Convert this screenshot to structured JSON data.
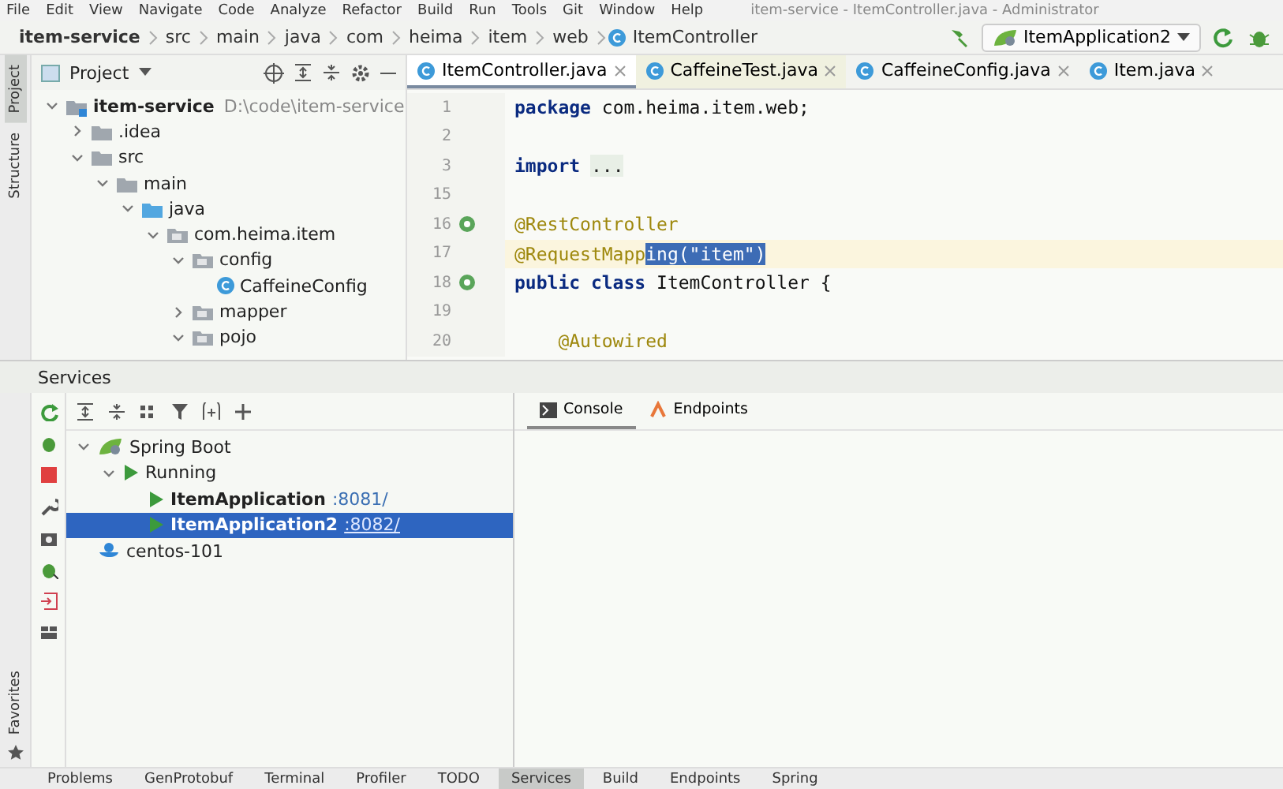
{
  "menu": [
    "File",
    "Edit",
    "View",
    "Navigate",
    "Code",
    "Analyze",
    "Refactor",
    "Build",
    "Run",
    "Tools",
    "Git",
    "Window",
    "Help"
  ],
  "window": {
    "title": "item-service - ItemController.java - Administrator"
  },
  "breadcrumbs": [
    "item-service",
    "src",
    "main",
    "java",
    "com",
    "heima",
    "item",
    "web",
    "ItemController"
  ],
  "run_config": {
    "label": "ItemApplication2"
  },
  "side_tabs": [
    {
      "label": "Project",
      "selected": true
    },
    {
      "label": "Structure",
      "selected": false
    }
  ],
  "project_panel": {
    "title": "Project",
    "tree": [
      {
        "label": "item-service",
        "path": "D:\\code\\item-service",
        "kind": "module",
        "expanded": true,
        "children": [
          {
            "label": ".idea",
            "kind": "folder",
            "expanded": false
          },
          {
            "label": "src",
            "kind": "folder",
            "expanded": true,
            "children": [
              {
                "label": "main",
                "kind": "folder",
                "expanded": true,
                "children": [
                  {
                    "label": "java",
                    "kind": "source",
                    "expanded": true,
                    "children": [
                      {
                        "label": "com.heima.item",
                        "kind": "package",
                        "expanded": true,
                        "children": [
                          {
                            "label": "config",
                            "kind": "package",
                            "expanded": true,
                            "children": [
                              {
                                "label": "CaffeineConfig",
                                "kind": "class"
                              }
                            ]
                          },
                          {
                            "label": "mapper",
                            "kind": "package",
                            "expanded": false
                          },
                          {
                            "label": "pojo",
                            "kind": "package",
                            "expanded": true
                          }
                        ]
                      }
                    ]
                  }
                ]
              }
            ]
          }
        ]
      }
    ]
  },
  "editor_tabs": [
    {
      "label": "ItemController.java",
      "selected": true
    },
    {
      "label": "CaffeineTest.java",
      "selected": false
    },
    {
      "label": "CaffeineConfig.java",
      "selected": false
    },
    {
      "label": "Item.java",
      "selected": false
    }
  ],
  "code_lines": [
    {
      "number": "1",
      "current": false,
      "tokens": [
        {
          "kind": "keyword",
          "text": "package"
        },
        {
          "kind": "plain",
          "text": " com.heima.item.web;"
        }
      ]
    },
    {
      "number": "2",
      "current": false
    },
    {
      "number": "3",
      "current": false,
      "tokens": [
        {
          "kind": "keyword",
          "text": "import"
        },
        {
          "kind": "folded",
          "text": "..."
        }
      ]
    },
    {
      "number": "15",
      "current": false
    },
    {
      "number": "16",
      "current": false,
      "bean_icon": true,
      "tokens": [
        {
          "kind": "annotation",
          "text": "@RestController"
        }
      ]
    },
    {
      "number": "17",
      "current": true,
      "tokens": [
        {
          "kind": "annotation",
          "text": "@RequestMapp"
        },
        {
          "kind": "selection",
          "text": "ing(\"item\")"
        }
      ]
    },
    {
      "number": "18",
      "current": false,
      "bean_icon": true,
      "tokens": [
        {
          "kind": "keyword",
          "text": "public class"
        },
        {
          "kind": "plain",
          "text": " ItemController {"
        }
      ]
    },
    {
      "number": "19",
      "current": false
    },
    {
      "number": "20",
      "current": false,
      "indented": true,
      "tokens": [
        {
          "kind": "annotation",
          "text": "@Autowired"
        }
      ]
    }
  ],
  "services": {
    "title": "Services",
    "tree": [
      {
        "label": "Spring Boot",
        "kind": "spring",
        "expanded": true,
        "selected": false,
        "children": [
          {
            "label": "Running",
            "kind": "group",
            "expanded": true,
            "selected": false,
            "children": [
              {
                "label": "ItemApplication",
                "port": ":8081/",
                "kind": "app",
                "selected": false
              },
              {
                "label": "ItemApplication2",
                "port": ":8082/",
                "kind": "app",
                "selected": true
              }
            ]
          }
        ]
      },
      {
        "label": "centos-101",
        "kind": "docker",
        "selected": false
      }
    ],
    "tabs": [
      {
        "label": "Console",
        "selected": true
      },
      {
        "label": "Endpoints",
        "selected": false
      }
    ]
  },
  "favorites": {
    "label": "Favorites"
  },
  "bottom_tabs": [
    {
      "label": "Problems",
      "selected": false
    },
    {
      "label": "GenProtobuf",
      "selected": false
    },
    {
      "label": "Terminal",
      "selected": false
    },
    {
      "label": "Profiler",
      "selected": false
    },
    {
      "label": "TODO",
      "selected": false
    },
    {
      "label": "Services",
      "selected": true
    },
    {
      "label": "Build",
      "selected": false
    },
    {
      "label": "Endpoints",
      "selected": false
    },
    {
      "label": "Spring",
      "selected": false
    }
  ]
}
